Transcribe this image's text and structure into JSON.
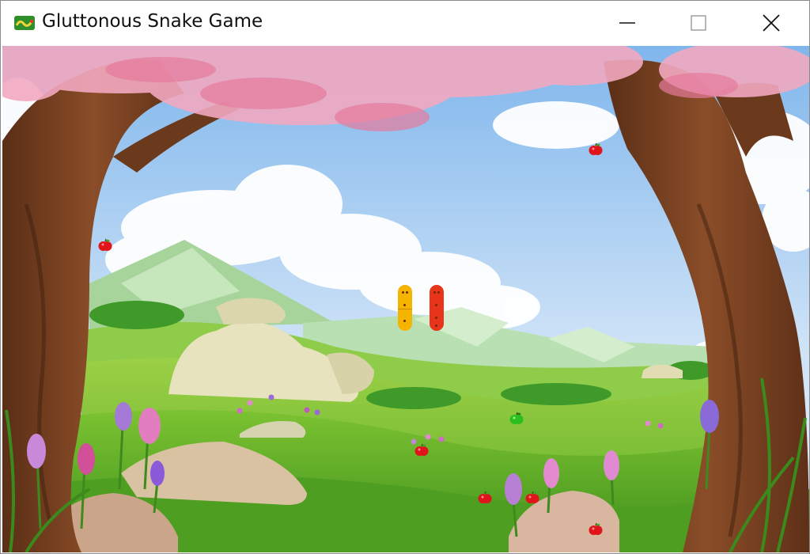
{
  "window": {
    "title": "Gluttonous Snake Game",
    "app_icon": "snake-game-icon",
    "controls": [
      "minimize-icon",
      "maximize-icon",
      "close-icon"
    ]
  },
  "game": {
    "background": "cherry-blossom-meadow",
    "snakes": [
      {
        "name": "player-snake",
        "color": "#f5b400",
        "segments": 2
      },
      {
        "name": "ai-snake",
        "color": "#e8341a",
        "segments": 2
      }
    ],
    "food": {
      "red_apple_count": 8,
      "green_apple_count": 1,
      "red_color": "#e0141b",
      "green_color": "#2bbf1e"
    }
  }
}
